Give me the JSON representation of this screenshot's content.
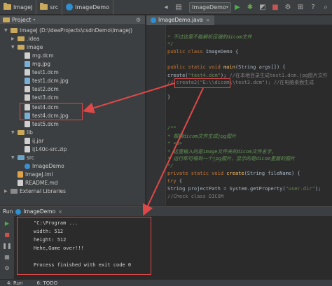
{
  "toolbar": {
    "project_name": "ImageJ",
    "folder_src": "src",
    "file_name": "ImageDemo",
    "run_config": "ImageDemo"
  },
  "project_panel": {
    "header": "Project",
    "tree": [
      {
        "label": "ImageJ (D:\\IdeaProjects\\csdnDemo\\ImageJ)",
        "type": "module"
      },
      {
        "label": ".idea",
        "type": "folder"
      },
      {
        "label": "image",
        "type": "folder"
      },
      {
        "label": "mg.dcm",
        "type": "file"
      },
      {
        "label": "mg.jpg",
        "type": "image"
      },
      {
        "label": "test1.dcm",
        "type": "file"
      },
      {
        "label": "test1.dcm.jpg",
        "type": "image"
      },
      {
        "label": "test2.dcm",
        "type": "file"
      },
      {
        "label": "test3.dcm",
        "type": "file"
      },
      {
        "label": "test4.dcm",
        "type": "file"
      },
      {
        "label": "test4.dcm.jpg",
        "type": "image"
      },
      {
        "label": "test5.dcm",
        "type": "file"
      },
      {
        "label": "lib",
        "type": "folder"
      },
      {
        "label": "ij.jar",
        "type": "file"
      },
      {
        "label": "ij140c-src.zip",
        "type": "file"
      },
      {
        "label": "src",
        "type": "source"
      },
      {
        "label": "ImageDemo",
        "type": "class"
      },
      {
        "label": "ImageJ.iml",
        "type": "xml"
      },
      {
        "label": "README.md",
        "type": "file"
      },
      {
        "label": "External Libraries",
        "type": "library"
      }
    ]
  },
  "editor": {
    "tab_label": "ImageDemo.java",
    "lines": [
      {
        "segments": [
          {
            "t": " * 不过这里不能解析压缩的dicom文件",
            "c": "it"
          }
        ]
      },
      {
        "segments": [
          {
            "t": " */",
            "c": "it"
          }
        ]
      },
      {
        "segments": [
          {
            "t": "public class ",
            "c": "kw"
          },
          {
            "t": "ImageDemo {",
            "c": "pl"
          }
        ]
      },
      {
        "segments": [
          {
            "t": "",
            "c": "pl"
          }
        ]
      },
      {
        "segments": [
          {
            "t": "    public static void ",
            "c": "kw"
          },
          {
            "t": "main",
            "c": "fn"
          },
          {
            "t": "(String args[]) {",
            "c": "pl"
          }
        ]
      },
      {
        "segments": [
          {
            "t": "        create(",
            "c": "pl"
          },
          {
            "t": "\"test4.dcm\"",
            "c": "st"
          },
          {
            "t": ");    ",
            "c": "pl"
          },
          {
            "t": "//在本地目录生成test1.dcm.jpg图片文件",
            "c": "cm"
          }
        ]
      },
      {
        "segments": [
          {
            "t": "        //      create2(\"E:\\\\dicom\\\\test3.dcm\");   //在电脑桌面生成",
            "c": "cm"
          }
        ]
      },
      {
        "segments": [
          {
            "t": "",
            "c": "pl"
          }
        ]
      },
      {
        "segments": [
          {
            "t": "    }",
            "c": "pl"
          }
        ]
      },
      {
        "segments": [
          {
            "t": "",
            "c": "pl"
          }
        ]
      },
      {
        "segments": [
          {
            "t": "",
            "c": "pl"
          }
        ]
      },
      {
        "segments": [
          {
            "t": "",
            "c": "pl"
          }
        ]
      },
      {
        "segments": [
          {
            "t": "    /**",
            "c": "it"
          }
        ]
      },
      {
        "segments": [
          {
            "t": "     * 根据dicom文件生成jpg图片",
            "c": "it"
          }
        ]
      },
      {
        "segments": [
          {
            "t": "     * <p>",
            "c": "it"
          }
        ]
      },
      {
        "segments": [
          {
            "t": "     * 这里输入的是image文件夹的dicom文件名字,",
            "c": "it"
          }
        ]
      },
      {
        "segments": [
          {
            "t": "     * 运行即可得到一个jpg图片，显示的是dicom里面的图片",
            "c": "it"
          }
        ]
      },
      {
        "segments": [
          {
            "t": "     */",
            "c": "it"
          }
        ]
      },
      {
        "segments": [
          {
            "t": "    private static void ",
            "c": "kw"
          },
          {
            "t": "create",
            "c": "fn"
          },
          {
            "t": "(String fileName) {",
            "c": "pl"
          }
        ]
      },
      {
        "segments": [
          {
            "t": "        try ",
            "c": "kw"
          },
          {
            "t": "{",
            "c": "pl"
          }
        ]
      },
      {
        "segments": [
          {
            "t": "            String projectPath = System.getProperty(",
            "c": "pl"
          },
          {
            "t": "\"user.dir\"",
            "c": "st"
          },
          {
            "t": ");",
            "c": "pl"
          }
        ]
      },
      {
        "segments": [
          {
            "t": "            //Check class DICOM",
            "c": "cm"
          }
        ]
      }
    ]
  },
  "run_panel": {
    "tab_label": "Run",
    "config_label": "ImageDemo",
    "console_lines": [
      "\"C:\\Program ...",
      "width: 512",
      "height: 512",
      "Hehe,Game over!!!",
      "",
      "Process finished with exit code 0"
    ]
  },
  "bottom_bar": {
    "tab_run": "4: Run",
    "tab_todo": "6: TODO"
  },
  "colors": {
    "annotation_red": "#e04848",
    "run_green": "#4caf50"
  }
}
